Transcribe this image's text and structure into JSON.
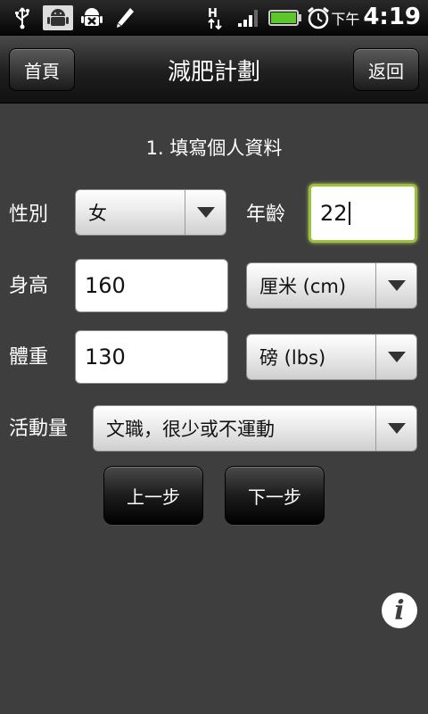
{
  "status_bar": {
    "icons": [
      "usb-icon",
      "android-debug-icon",
      "android-error-icon",
      "pencil-icon",
      "data-transfer-icon",
      "signal-icon",
      "battery-icon",
      "alarm-icon"
    ],
    "network_label": "H",
    "ampm": "下午",
    "time": "4:19",
    "battery_color": "#5cc62b"
  },
  "title_bar": {
    "title": "減肥計劃",
    "home_label": "首頁",
    "back_label": "返回"
  },
  "form": {
    "section_title": "1. 填寫個人資料",
    "gender": {
      "label": "性別",
      "value": "女"
    },
    "age": {
      "label": "年齡",
      "value": "22"
    },
    "height": {
      "label": "身高",
      "value": "160",
      "unit": "厘米 (cm)"
    },
    "weight": {
      "label": "體重",
      "value": "130",
      "unit": "磅 (lbs)"
    },
    "activity": {
      "label": "活動量",
      "value": "文職，很少或不運動"
    }
  },
  "buttons": {
    "prev_label": "上一步",
    "next_label": "下一步",
    "info_glyph": "i"
  },
  "colors": {
    "background": "#3e3e3e",
    "focus_border": "#9cbf3c"
  }
}
